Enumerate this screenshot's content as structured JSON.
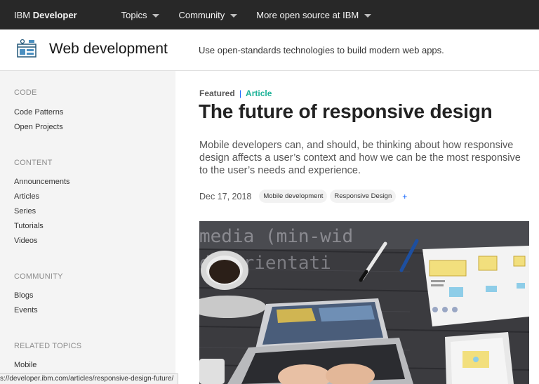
{
  "topnav": {
    "brand_prefix": "IBM",
    "brand_name": "Developer",
    "items": [
      {
        "label": "Topics"
      },
      {
        "label": "Community"
      },
      {
        "label": "More open source at IBM"
      }
    ]
  },
  "header": {
    "title": "Web development",
    "tagline": "Use open-standards technologies to build modern web apps."
  },
  "sidebar": {
    "sections": [
      {
        "heading": "CODE",
        "links": [
          "Code Patterns",
          "Open Projects"
        ]
      },
      {
        "heading": "CONTENT",
        "links": [
          "Announcements",
          "Articles",
          "Series",
          "Tutorials",
          "Videos"
        ]
      },
      {
        "heading": "COMMUNITY",
        "links": [
          "Blogs",
          "Events"
        ]
      },
      {
        "heading": "RELATED TOPICS",
        "links": [
          "Mobile"
        ]
      }
    ]
  },
  "article": {
    "featured_label": "Featured",
    "separator": "|",
    "type_label": "Article",
    "title": "The future of responsive design",
    "summary": "Mobile developers can, and should, be thinking about how responsive design affects a user’s context and how we can be the most responsive to the user’s needs and experience.",
    "date": "Dec 17, 2018",
    "tags": [
      "Mobile development",
      "Responsive Design"
    ],
    "more_tags": "+",
    "hero_code_line1": "media (min-wid",
    "hero_code_line2": "d (orientati"
  },
  "statusbar": {
    "url": "s://developer.ibm.com/articles/responsive-design-future/"
  },
  "colors": {
    "topnav_bg": "#282828",
    "sidebar_bg": "#f4f4f4",
    "accent_blue": "#0f62fe",
    "accent_teal": "#1fb399"
  }
}
